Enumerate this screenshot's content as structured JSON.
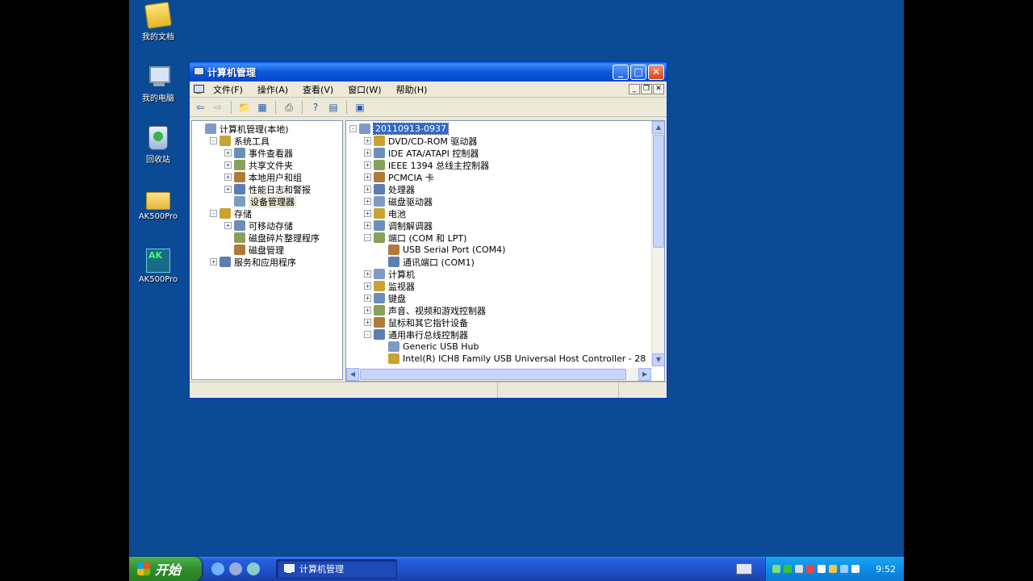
{
  "desktop": {
    "icons": [
      {
        "label": "我的文档",
        "icon": "my-documents-icon"
      },
      {
        "label": "我的电脑",
        "icon": "my-computer-icon"
      },
      {
        "label": "回收站",
        "icon": "recycle-bin-icon"
      },
      {
        "label": "AK500Pro",
        "icon": "folder-icon"
      },
      {
        "label": "AK500Pro",
        "icon": "ak500pro-app-icon"
      }
    ]
  },
  "window": {
    "title": "计算机管理",
    "menu": [
      "文件(F)",
      "操作(A)",
      "查看(V)",
      "窗口(W)",
      "帮助(H)"
    ],
    "left_tree": [
      {
        "label": "计算机管理(本地)",
        "indent": 0,
        "expander": "",
        "selected": false
      },
      {
        "label": "系统工具",
        "indent": 1,
        "expander": "-",
        "selected": false
      },
      {
        "label": "事件查看器",
        "indent": 2,
        "expander": "+",
        "selected": false
      },
      {
        "label": "共享文件夹",
        "indent": 2,
        "expander": "+",
        "selected": false
      },
      {
        "label": "本地用户和组",
        "indent": 2,
        "expander": "+",
        "selected": false
      },
      {
        "label": "性能日志和警报",
        "indent": 2,
        "expander": "+",
        "selected": false
      },
      {
        "label": "设备管理器",
        "indent": 2,
        "expander": "",
        "selected": true
      },
      {
        "label": "存储",
        "indent": 1,
        "expander": "-",
        "selected": false
      },
      {
        "label": "可移动存储",
        "indent": 2,
        "expander": "+",
        "selected": false
      },
      {
        "label": "磁盘碎片整理程序",
        "indent": 2,
        "expander": "",
        "selected": false
      },
      {
        "label": "磁盘管理",
        "indent": 2,
        "expander": "",
        "selected": false
      },
      {
        "label": "服务和应用程序",
        "indent": 1,
        "expander": "+",
        "selected": false
      }
    ],
    "device_tree": [
      {
        "label": "20110913-0937",
        "indent": 0,
        "expander": "-",
        "selected": true
      },
      {
        "label": "DVD/CD-ROM 驱动器",
        "indent": 1,
        "expander": "+",
        "selected": false
      },
      {
        "label": "IDE ATA/ATAPI 控制器",
        "indent": 1,
        "expander": "+",
        "selected": false
      },
      {
        "label": "IEEE 1394 总线主控制器",
        "indent": 1,
        "expander": "+",
        "selected": false
      },
      {
        "label": "PCMCIA 卡",
        "indent": 1,
        "expander": "+",
        "selected": false
      },
      {
        "label": "处理器",
        "indent": 1,
        "expander": "+",
        "selected": false
      },
      {
        "label": "磁盘驱动器",
        "indent": 1,
        "expander": "+",
        "selected": false
      },
      {
        "label": "电池",
        "indent": 1,
        "expander": "+",
        "selected": false
      },
      {
        "label": "调制解调器",
        "indent": 1,
        "expander": "+",
        "selected": false
      },
      {
        "label": "端口 (COM 和 LPT)",
        "indent": 1,
        "expander": "-",
        "selected": false
      },
      {
        "label": "USB Serial Port (COM4)",
        "indent": 2,
        "expander": "",
        "selected": false
      },
      {
        "label": "通讯端口 (COM1)",
        "indent": 2,
        "expander": "",
        "selected": false
      },
      {
        "label": "计算机",
        "indent": 1,
        "expander": "+",
        "selected": false
      },
      {
        "label": "监视器",
        "indent": 1,
        "expander": "+",
        "selected": false
      },
      {
        "label": "键盘",
        "indent": 1,
        "expander": "+",
        "selected": false
      },
      {
        "label": "声音、视频和游戏控制器",
        "indent": 1,
        "expander": "+",
        "selected": false
      },
      {
        "label": "鼠标和其它指针设备",
        "indent": 1,
        "expander": "+",
        "selected": false
      },
      {
        "label": "通用串行总线控制器",
        "indent": 1,
        "expander": "-",
        "selected": false
      },
      {
        "label": "Generic USB Hub",
        "indent": 2,
        "expander": "",
        "selected": false
      },
      {
        "label": "Intel(R) ICH8 Family USB Universal Host Controller - 28",
        "indent": 2,
        "expander": "",
        "selected": false
      }
    ]
  },
  "taskbar": {
    "start_label": "开始",
    "task_button_label": "计算机管理",
    "clock": "9:52"
  },
  "colors": {
    "desktop_bg": "#0b4a94",
    "selection": "#316ac5",
    "tray_bg": "#0e8ce6"
  }
}
